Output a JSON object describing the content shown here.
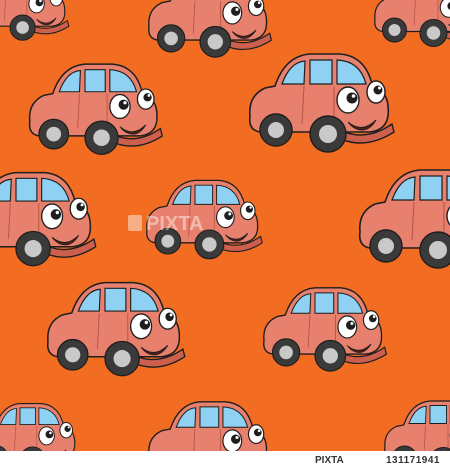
{
  "colors": {
    "background": "#f26d22",
    "car_body": "#e8806e",
    "car_shadow": "#cd5f4f",
    "window": "#8fd1f2",
    "tire": "#3a3a3a",
    "hub": "#c9c9c9",
    "outline": "#1e1e1e"
  },
  "watermark": {
    "brand": "PIXTA"
  },
  "credit": {
    "brand": "PIXTA",
    "image_number": "131171941"
  },
  "icons": [
    "cartoon-car-icon",
    "pixta-logo-icon"
  ]
}
